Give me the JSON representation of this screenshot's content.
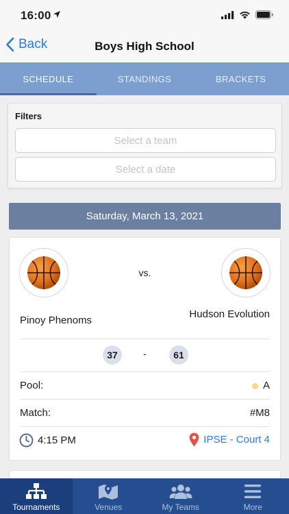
{
  "status": {
    "time": "16:00"
  },
  "nav": {
    "back_label": "Back",
    "title": "Boys High School"
  },
  "tabs": [
    {
      "label": "SCHEDULE",
      "active": true
    },
    {
      "label": "STANDINGS",
      "active": false
    },
    {
      "label": "BRACKETS",
      "active": false
    }
  ],
  "filters": {
    "label": "Filters",
    "team_placeholder": "Select a team",
    "date_placeholder": "Select a date"
  },
  "date_header": "Saturday, March 13, 2021",
  "match": {
    "home_team": "Pinoy Phenoms",
    "away_team": "Hudson Evolution",
    "vs": "vs.",
    "home_score": "37",
    "away_score": "61",
    "score_separator": "-",
    "pool_label": "Pool:",
    "pool_value": "A",
    "pool_color": "#f3dd7a",
    "match_label": "Match:",
    "match_value": "#M8",
    "time": "4:15 PM",
    "venue": "IPSE - Court 4",
    "team_logo_icon": "basketball-icon"
  },
  "tabbar": [
    {
      "label": "Tournaments",
      "icon": "bracket-tree-icon",
      "active": true
    },
    {
      "label": "Venues",
      "icon": "map-marker-icon",
      "active": false
    },
    {
      "label": "My Teams",
      "icon": "people-group-icon",
      "active": false
    },
    {
      "label": "More",
      "icon": "hamburger-menu-icon",
      "active": false
    }
  ],
  "colors": {
    "accent": "#2a7ae2",
    "tab_bar_bg": "#7d9fd0",
    "date_header_bg": "#6b7fa1",
    "bottom_bar_bg": "#254e91",
    "venue_pin": "#e05545"
  }
}
